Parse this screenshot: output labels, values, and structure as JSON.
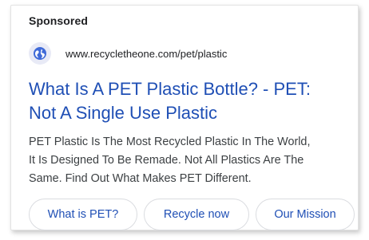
{
  "ad": {
    "label": "Sponsored",
    "url": "www.recycletheone.com/pet/plastic",
    "favicon_icon": "globe-icon",
    "headline_line1": "What Is A PET Plastic Bottle? - PET:",
    "headline_line2": "Not A Single Use Plastic",
    "description_line1": "PET Plastic Is The Most Recycled Plastic In The World,",
    "description_line2": "It Is Designed To Be Remade. Not All Plastics Are The",
    "description_line3": "Same. Find Out What Makes PET Different.",
    "sitelinks": [
      "What is PET?",
      "Recycle now",
      "Our Mission"
    ]
  },
  "colors": {
    "link": "#1f4fb5",
    "text": "#3c4043",
    "favicon_bg": "#e8eaf6"
  }
}
